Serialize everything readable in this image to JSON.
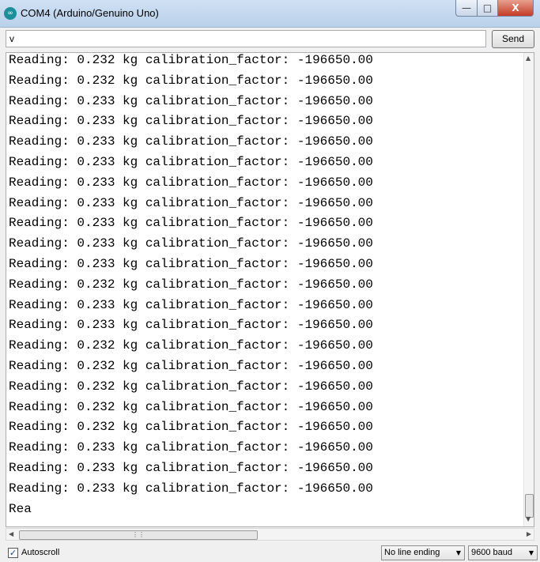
{
  "window": {
    "title": "COM4 (Arduino/Genuino Uno)",
    "icon": "arduino-icon",
    "icon_glyph": "∞",
    "controls": {
      "minimize": "—",
      "maximize": "□",
      "close": "X"
    }
  },
  "input": {
    "value": "v"
  },
  "send_label": "Send",
  "output": {
    "lines": [
      "Reading: 0.232 kg calibration_factor: -196650.00",
      "Reading: 0.232 kg calibration_factor: -196650.00",
      "Reading: 0.233 kg calibration_factor: -196650.00",
      "Reading: 0.233 kg calibration_factor: -196650.00",
      "Reading: 0.233 kg calibration_factor: -196650.00",
      "Reading: 0.233 kg calibration_factor: -196650.00",
      "Reading: 0.233 kg calibration_factor: -196650.00",
      "Reading: 0.233 kg calibration_factor: -196650.00",
      "Reading: 0.233 kg calibration_factor: -196650.00",
      "Reading: 0.233 kg calibration_factor: -196650.00",
      "Reading: 0.233 kg calibration_factor: -196650.00",
      "Reading: 0.232 kg calibration_factor: -196650.00",
      "Reading: 0.233 kg calibration_factor: -196650.00",
      "Reading: 0.233 kg calibration_factor: -196650.00",
      "Reading: 0.232 kg calibration_factor: -196650.00",
      "Reading: 0.232 kg calibration_factor: -196650.00",
      "Reading: 0.232 kg calibration_factor: -196650.00",
      "Reading: 0.232 kg calibration_factor: -196650.00",
      "Reading: 0.232 kg calibration_factor: -196650.00",
      "Reading: 0.233 kg calibration_factor: -196650.00",
      "Reading: 0.233 kg calibration_factor: -196650.00",
      "Reading: 0.233 kg calibration_factor: -196650.00",
      "Rea"
    ]
  },
  "status": {
    "autoscroll_label": "Autoscroll",
    "autoscroll_checked": true,
    "line_ending": "No line ending",
    "baud": "9600 baud"
  }
}
